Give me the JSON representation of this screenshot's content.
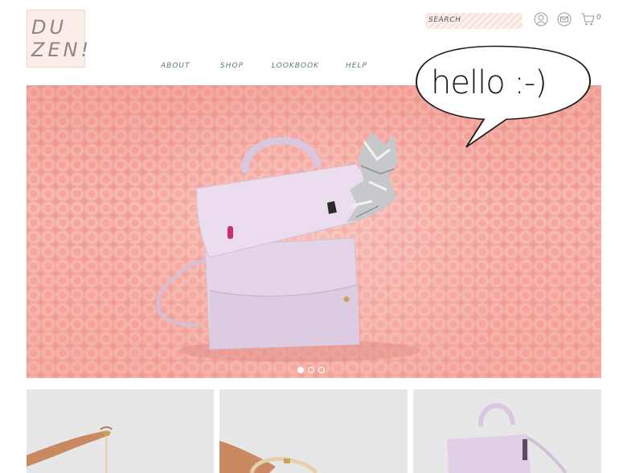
{
  "logo": {
    "line1": "DU",
    "line2": "ZEN!"
  },
  "header": {
    "search_label": "SEARCH",
    "account_icon": "user-icon",
    "mail_icon": "envelope-icon",
    "cart_icon": "cart-icon",
    "cart_count": "0"
  },
  "nav": [
    {
      "label": "ABOUT"
    },
    {
      "label": "SHOP"
    },
    {
      "label": "LOOKBOOK"
    },
    {
      "label": "HELP"
    }
  ],
  "hero": {
    "speech_bubble_text": "hello :-)",
    "slide_count": 3,
    "active_slide": 1
  },
  "products": [
    {
      "image": "hand-holding-bag-strap"
    },
    {
      "image": "hand-holding-bag-handle"
    },
    {
      "image": "lilac-backpack"
    }
  ],
  "colors": {
    "accent_nav": "#5a7d7a",
    "logo_bg": "#fbeee9",
    "hero_pink": "#f6b1a8",
    "bag_lilac": "#e1cfe6"
  }
}
